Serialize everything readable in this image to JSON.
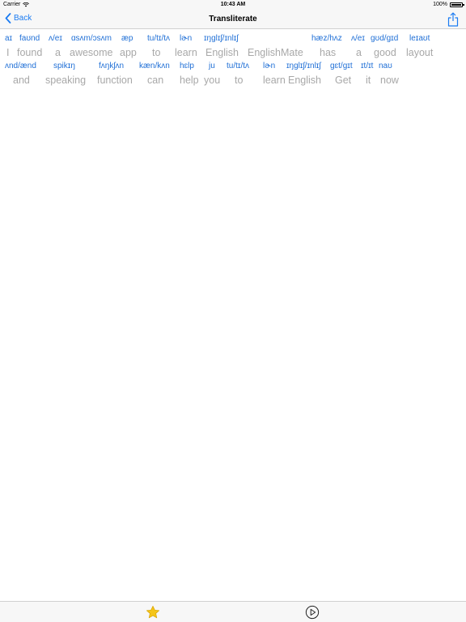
{
  "status_bar": {
    "carrier": "Carrier",
    "time": "10:43 AM",
    "battery": "100%"
  },
  "nav_bar": {
    "back_label": "Back",
    "title": "Transliterate",
    "share_icon": "share-icon",
    "back_icon": "chevron-left-icon"
  },
  "lines": [
    {
      "words": [
        {
          "ipa": "aɪ",
          "text": "I"
        },
        {
          "ipa": "faʊnd",
          "text": "found"
        },
        {
          "ipa": "ʌ/eɪ",
          "text": "a"
        },
        {
          "ipa": "ɑsʌm/ɔsʌm",
          "text": "awesome"
        },
        {
          "ipa": "æp",
          "text": "app"
        },
        {
          "ipa": "tu/tɪ/tʌ",
          "text": "to"
        },
        {
          "ipa": "lɚn",
          "text": "learn"
        },
        {
          "ipa": "ɪŋglɪʃ/ɪnlɪʃ",
          "text": "English"
        },
        {
          "ipa": "",
          "text": "EnglishMate"
        },
        {
          "ipa": "hæz/hʌz",
          "text": "has"
        },
        {
          "ipa": "ʌ/eɪ",
          "text": "a"
        },
        {
          "ipa": "gʊd/gɪd",
          "text": "good"
        },
        {
          "ipa": "leɪaʊt",
          "text": "layout"
        }
      ]
    },
    {
      "words": [
        {
          "ipa": "ʌnd/ænd",
          "text": "and"
        },
        {
          "ipa": "spikɪŋ",
          "text": "speaking"
        },
        {
          "ipa": "fʌŋkʃʌn",
          "text": "function"
        },
        {
          "ipa": "kæn/kʌn",
          "text": "can"
        },
        {
          "ipa": "hɛlp",
          "text": "help"
        },
        {
          "ipa": "ju",
          "text": "you"
        },
        {
          "ipa": "tu/tɪ/tʌ",
          "text": "to"
        },
        {
          "ipa": "lɚn",
          "text": "learn"
        },
        {
          "ipa": "ɪŋglɪʃ/ɪnlɪʃ",
          "text": "English"
        },
        {
          "ipa": "gɛt/gɪt",
          "text": "Get"
        },
        {
          "ipa": "ɪt/ɪt",
          "text": "it"
        },
        {
          "ipa": "naʊ",
          "text": "now"
        }
      ]
    }
  ],
  "tab_bar": {
    "favorite_icon": "star-icon",
    "play_icon": "play-circle-icon",
    "accent_color": "#1a7bf2",
    "star_color": "#f5c518"
  }
}
